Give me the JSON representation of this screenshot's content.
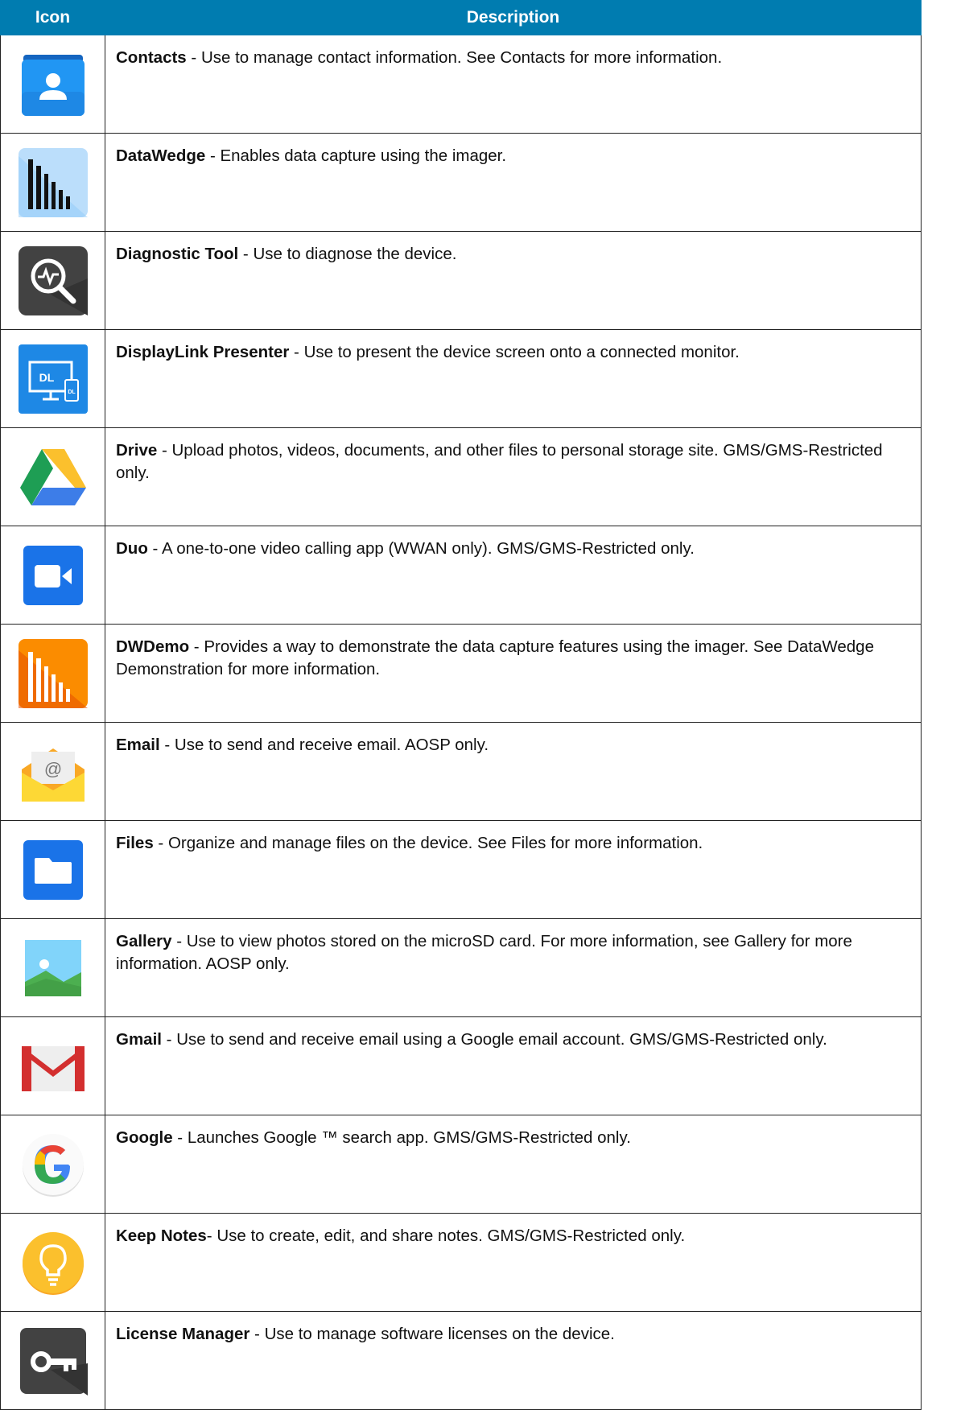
{
  "table": {
    "headers": [
      "Icon",
      "Description"
    ],
    "rows": [
      {
        "icon": "contacts-icon",
        "name": "Contacts",
        "sep": " - ",
        "text": "Use to manage contact information. See Contacts for more information."
      },
      {
        "icon": "datawedge-icon",
        "name": "DataWedge",
        "sep": " - ",
        "text": "Enables data capture using the imager."
      },
      {
        "icon": "diagnostic-tool-icon",
        "name": "Diagnostic Tool",
        "sep": " - ",
        "text": "Use to diagnose the device."
      },
      {
        "icon": "displaylink-presenter-icon",
        "name": "DisplayLink Presenter",
        "sep": " - ",
        "text": "Use to present the device screen onto a connected monitor."
      },
      {
        "icon": "drive-icon",
        "name": "Drive",
        "sep": " - ",
        "text": "Upload photos, videos, documents, and other files to personal storage site. GMS/GMS-Restricted only."
      },
      {
        "icon": "duo-icon",
        "name": "Duo",
        "sep": " - ",
        "text": "A one-to-one video calling app (WWAN only). GMS/GMS-Restricted only."
      },
      {
        "icon": "dwdemo-icon",
        "name": "DWDemo",
        "sep": " - ",
        "text": "Provides a way to demonstrate the data capture features using the imager. See DataWedge Demonstration for more information."
      },
      {
        "icon": "email-icon",
        "name": "Email",
        "sep": " - ",
        "text": "Use to send and receive email. AOSP only."
      },
      {
        "icon": "files-icon",
        "name": "Files",
        "sep": " - ",
        "text": "Organize and manage files on the device. See Files for more information."
      },
      {
        "icon": "gallery-icon",
        "name": "Gallery",
        "sep": " - ",
        "text": "Use to view photos stored on the microSD card. For more information, see Gallery for more information. AOSP only."
      },
      {
        "icon": "gmail-icon",
        "name": "Gmail",
        "sep": " - ",
        "text": "Use to send and receive email using a Google email account. GMS/GMS-Restricted only."
      },
      {
        "icon": "google-icon",
        "name": "Google",
        "sep": " - ",
        "text": "Launches Google ™ search app. GMS/GMS-Restricted only."
      },
      {
        "icon": "keep-notes-icon",
        "name": "Keep Notes",
        "sep": "- ",
        "text": "Use to create, edit, and share notes. GMS/GMS-Restricted only."
      },
      {
        "icon": "license-manager-icon",
        "name": "License Manager",
        "sep": " - ",
        "text": "Use to manage software licenses on the device."
      }
    ],
    "icon_glyphs": {
      "displaylink_big": "DL",
      "displaylink_small": "DL",
      "email_at": "@",
      "google_g": "G"
    }
  }
}
